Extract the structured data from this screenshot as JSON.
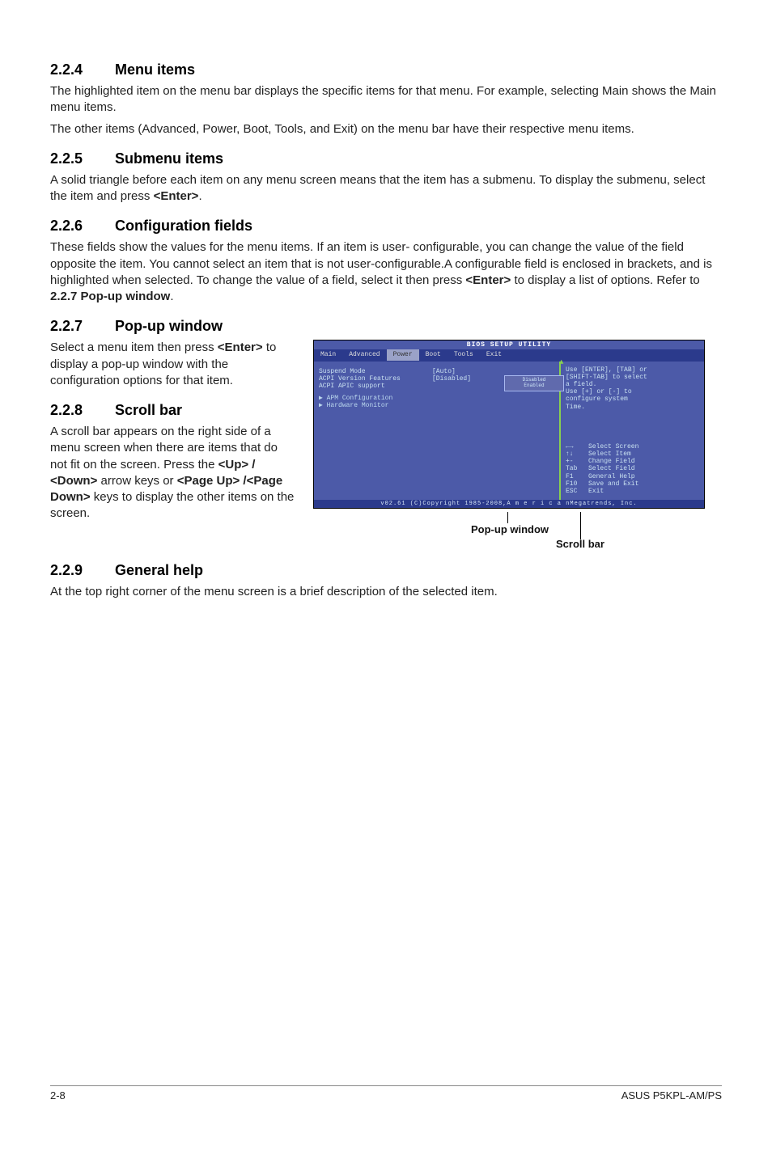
{
  "s224": {
    "num": "2.2.4",
    "title": "Menu items",
    "p1": "The highlighted item on the menu bar displays the specific items for that menu. For example, selecting Main shows the Main menu items.",
    "p2": "The other items (Advanced, Power, Boot, Tools, and Exit) on the menu bar have their respective menu items."
  },
  "s225": {
    "num": "2.2.5",
    "title": "Submenu items",
    "p1_a": "A solid triangle before each item on any menu screen means that the item has a submenu. To display the submenu, select the item and press ",
    "p1_key": "<Enter>",
    "p1_b": "."
  },
  "s226": {
    "num": "2.2.6",
    "title": "Configuration fields",
    "p1_a": "These fields show the values for the menu items. If an item is user- configurable, you can change the value of the field opposite the item. You cannot select an item that is not user-configurable.A configurable field is enclosed in brackets, and is highlighted when selected. To change the value of a field, select it then press ",
    "p1_key": "<Enter>",
    "p1_b": " to display a list of options. Refer to ",
    "p1_bold": "2.2.7 Pop-up window",
    "p1_c": "."
  },
  "s227": {
    "num": "2.2.7",
    "title": "Pop-up window",
    "p1_a": "Select a menu item then press ",
    "p1_key": "<Enter>",
    "p1_b": " to display a pop-up window with the configuration options for that item."
  },
  "s228": {
    "num": "2.2.8",
    "title": "Scroll bar",
    "p1_a": "A scroll bar appears on the right side of a menu screen when there are items that do not fit on the screen. Press the ",
    "p1_k1": "<Up> / <Down>",
    "p1_b": " arrow keys or ",
    "p1_k2": "<Page Up> /<Page Down>",
    "p1_c": " keys to display the other items on the screen."
  },
  "s229": {
    "num": "2.2.9",
    "title": "General help",
    "p1": "At the top right corner of the menu screen is a brief description of the selected item."
  },
  "bios": {
    "title": "BIOS SETUP UTILITY",
    "menu": [
      "Main",
      "Advanced",
      "Power",
      "Boot",
      "Tools",
      "Exit"
    ],
    "rows": [
      {
        "label": "Suspend Mode",
        "val": "[Auto]"
      },
      {
        "label": "ACPI Version Features",
        "val": "[Disabled]"
      },
      {
        "label": "ACPI APIC support",
        "val": ""
      }
    ],
    "submenus": [
      "APM Configuration",
      "Hardware Monitor"
    ],
    "popup": [
      "Disabled",
      "Enabled"
    ],
    "help_top": [
      "Use [ENTER], [TAB] or",
      "[SHIFT-TAB] to select",
      "a field.",
      "",
      "Use [+] or [-] to",
      "configure system",
      "Time."
    ],
    "help_keys": [
      {
        "k": "←→",
        "t": "Select Screen"
      },
      {
        "k": "↑↓",
        "t": "Select Item"
      },
      {
        "k": "+-",
        "t": "Change Field"
      },
      {
        "k": "Tab",
        "t": "Select Field"
      },
      {
        "k": "F1",
        "t": "General Help"
      },
      {
        "k": "F10",
        "t": "Save and Exit"
      },
      {
        "k": "ESC",
        "t": "Exit"
      }
    ],
    "foot": "v02.61 (C)Copyright 1985-2008,A m e r i c a nMegatrends, Inc.",
    "caption_popup": "Pop-up window",
    "caption_scroll": "Scroll bar"
  },
  "footer": {
    "left": "2-8",
    "right": "ASUS P5KPL-AM/PS"
  }
}
